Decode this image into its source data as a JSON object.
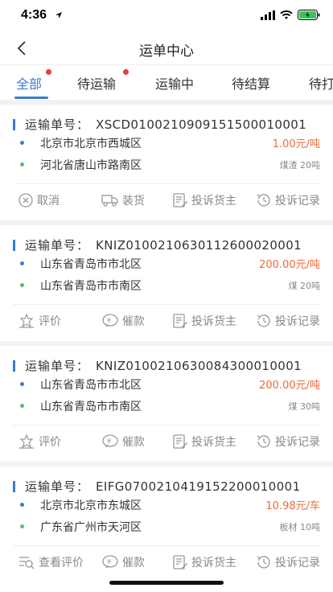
{
  "status": {
    "time": "4:36"
  },
  "nav": {
    "title": "运单中心"
  },
  "tabs": [
    {
      "label": "全部"
    },
    {
      "label": "待运输"
    },
    {
      "label": "运输中"
    },
    {
      "label": "待结算"
    },
    {
      "label": "待打"
    }
  ],
  "colors": {
    "accent": "#3a7bd5",
    "price": "#ee6a3a",
    "start_dot": "#3a7bd5",
    "end_dot": "#4fc36a",
    "badge": "#e83a3a"
  },
  "orders": [
    {
      "label": "运输单号：",
      "number": "XSCD010021090915150001​0001",
      "from": "北京市北京市西城区",
      "to": "河北省唐山市路南区",
      "price": "1.00元/吨",
      "cargo": "煤渣 20吨",
      "actions": [
        {
          "icon": "cancel-icon",
          "label": "取消"
        },
        {
          "icon": "truck-icon",
          "label": "装货"
        },
        {
          "icon": "complaint-icon",
          "label": "投诉货主"
        },
        {
          "icon": "history-icon",
          "label": "投诉记录"
        }
      ]
    },
    {
      "label": "运输单号：",
      "number": "KNIZ010021063011260002​0001",
      "from": "山东省青岛市市北区",
      "to": "山东省青岛市市南区",
      "price": "200.00元/吨",
      "cargo": "煤 20吨",
      "actions": [
        {
          "icon": "rate-icon",
          "label": "评价"
        },
        {
          "icon": "remind-icon",
          "label": "催款"
        },
        {
          "icon": "complaint-icon",
          "label": "投诉货主"
        },
        {
          "icon": "history-icon",
          "label": "投诉记录"
        }
      ]
    },
    {
      "label": "运输单号：",
      "number": "KNIZ010021063008430001​0001",
      "from": "山东省青岛市市北区",
      "to": "山东省青岛市市南区",
      "price": "200.00元/吨",
      "cargo": "煤 30吨",
      "actions": [
        {
          "icon": "rate-icon",
          "label": "评价"
        },
        {
          "icon": "remind-icon",
          "label": "催款"
        },
        {
          "icon": "complaint-icon",
          "label": "投诉货主"
        },
        {
          "icon": "history-icon",
          "label": "投诉记录"
        }
      ]
    },
    {
      "label": "运输单号：",
      "number": "EIFG070021041915220001​0001",
      "from": "北京市北京市东城区",
      "to": "广东省广州市天河区",
      "price": "10.98元/车",
      "cargo": "板材 10吨",
      "actions": [
        {
          "icon": "view-rating-icon",
          "label": "查看评价"
        },
        {
          "icon": "remind-icon",
          "label": "催款"
        },
        {
          "icon": "complaint-icon",
          "label": "投诉货主"
        },
        {
          "icon": "history-icon",
          "label": "投诉记录"
        }
      ]
    }
  ]
}
